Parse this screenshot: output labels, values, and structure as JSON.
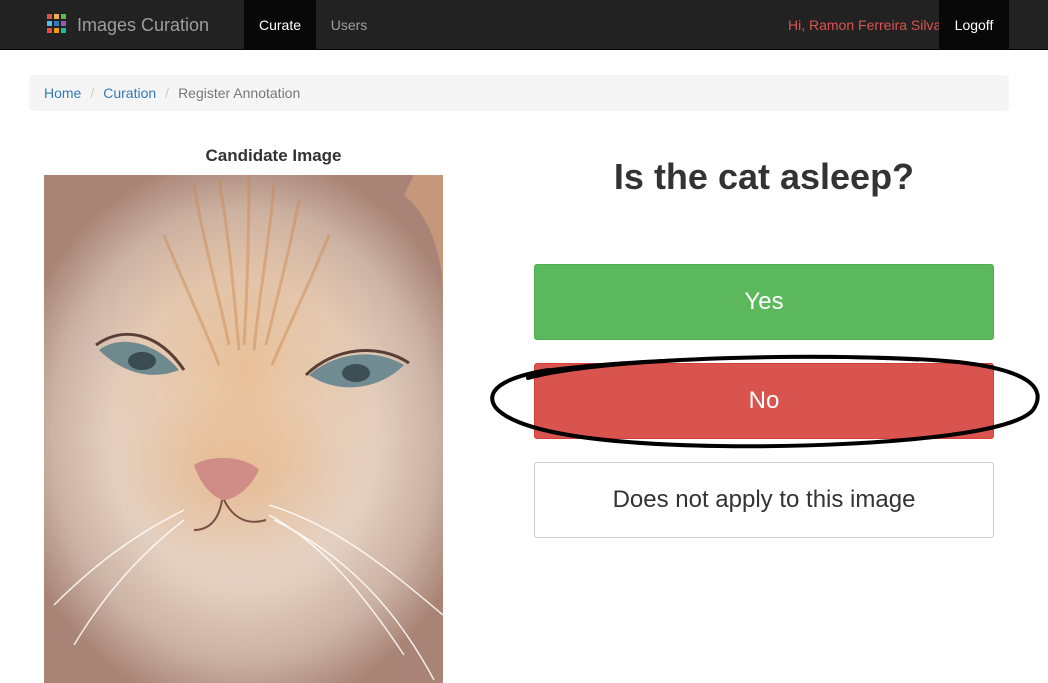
{
  "navbar": {
    "brand": "Images Curation",
    "logo_colors": [
      "#d9534f",
      "#f0ad4e",
      "#5cb85c",
      "#5bc0de",
      "#337ab7",
      "#9b59b6",
      "#e74c3c",
      "#f39c12",
      "#1abc9c"
    ],
    "tabs": [
      {
        "label": "Curate",
        "active": true
      },
      {
        "label": "Users",
        "active": false
      }
    ],
    "greeting": "Hi, Ramon Ferreira Silva",
    "logoff_label": "Logoff"
  },
  "breadcrumb": {
    "items": [
      "Home",
      "Curation",
      "Register Annotation"
    ],
    "separator": "/"
  },
  "candidate": {
    "title": "Candidate Image",
    "image_subject": "cat"
  },
  "question": "Is the cat asleep?",
  "answers": {
    "yes": "Yes",
    "no": "No",
    "not_applicable": "Does not apply to this image"
  },
  "colors": {
    "success": "#5cb85c",
    "danger": "#d9534f",
    "link": "#337ab7",
    "navbar": "#222222"
  }
}
